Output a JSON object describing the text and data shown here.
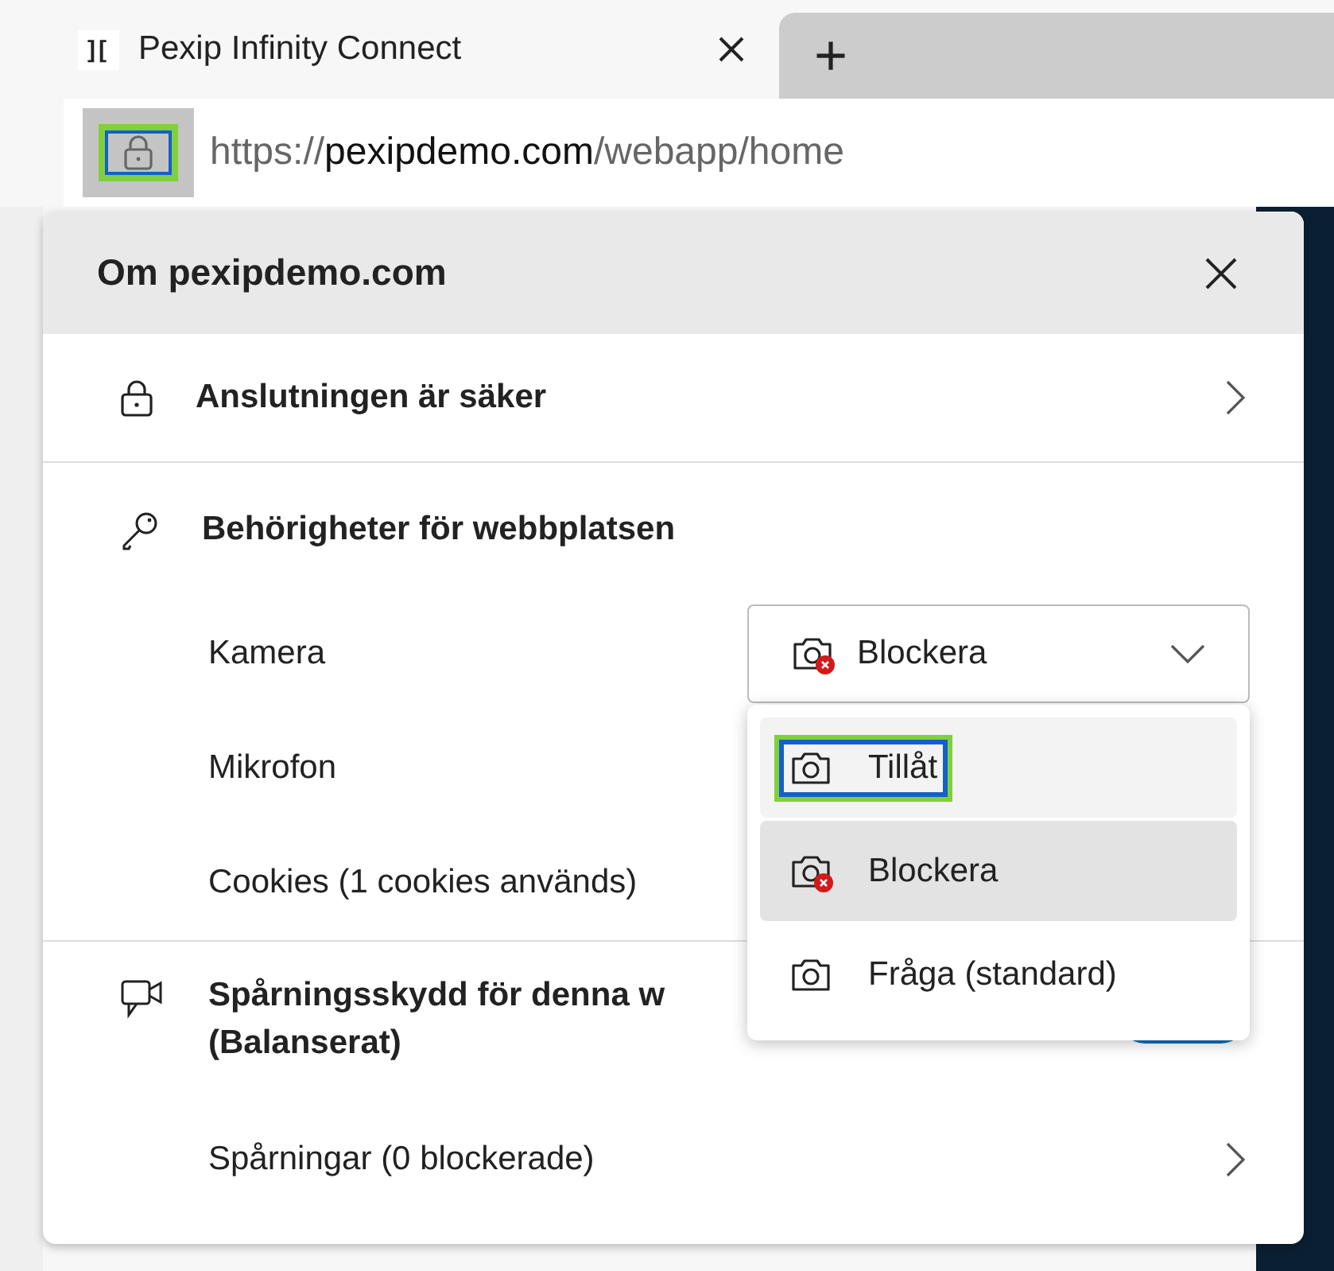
{
  "tabs": [
    {
      "favicon": "][",
      "title": "Pexip Infinity Connect",
      "selected": true
    }
  ],
  "new_tab": "+",
  "address_bar": {
    "lock_highlighted": true,
    "url_scheme": "https://",
    "url_host": "pexipdemo.com",
    "url_path": "/webapp/home"
  },
  "popup": {
    "title": "Om pexipdemo.com",
    "connection": {
      "label": "Anslutningen är säker"
    },
    "permissions": {
      "heading": "Behörigheter för webbplatsen",
      "items": [
        {
          "label": "Kamera",
          "kind": "select",
          "value": "Blockera",
          "blocked": true
        },
        {
          "label": "Mikrofon",
          "kind": "plain"
        },
        {
          "label": "Cookies (1 cookies används)",
          "kind": "plain"
        }
      ]
    },
    "tracking": {
      "label": "Spårningsskydd för denna w",
      "sublabel": "(Balanserat)",
      "on": true
    },
    "trackers": {
      "label": "Spårningar (0 blockerade)"
    }
  },
  "dropdown": {
    "options": [
      {
        "label": "Tillåt",
        "blocked": false,
        "selected": false,
        "highlighted": true
      },
      {
        "label": "Blockera",
        "blocked": true,
        "selected": true,
        "highlighted": false
      },
      {
        "label": "Fråga (standard)",
        "blocked": false,
        "selected": false,
        "highlighted": false
      }
    ]
  }
}
